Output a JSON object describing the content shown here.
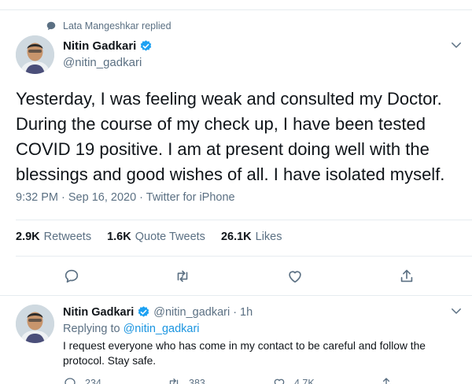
{
  "social_context": {
    "text": "Lata Mangeshkar replied",
    "icon": "reply-icon"
  },
  "tweet": {
    "author": {
      "name": "Nitin Gadkari",
      "handle": "@nitin_gadkari",
      "verified": true
    },
    "text": "Yesterday, I was feeling weak and consulted my Doctor. During the course of my check up, I have been tested COVID 19 positive. I am at present doing well with the blessings and good wishes of all. I have isolated myself.",
    "meta": "9:32 PM · Sep 16, 2020 · Twitter for iPhone",
    "stats": [
      {
        "count": "2.9K",
        "label": "Retweets"
      },
      {
        "count": "1.6K",
        "label": "Quote Tweets"
      },
      {
        "count": "26.1K",
        "label": "Likes"
      }
    ],
    "actions": [
      "reply-icon",
      "retweet-icon",
      "like-icon",
      "share-icon"
    ]
  },
  "reply": {
    "author": {
      "name": "Nitin Gadkari",
      "handle": "@nitin_gadkari",
      "time": "1h",
      "separator": "·",
      "verified": true
    },
    "replying_prefix": "Replying to ",
    "replying_to": "@nitin_gadkari",
    "text": "I request everyone who has come in my contact to be careful and follow the protocol. Stay safe.",
    "action_counts": {
      "reply": "234",
      "retweet": "383",
      "like": "4.7K"
    }
  },
  "colors": {
    "accent": "#1da1f2",
    "mention": "#1b95e0",
    "secondary_text": "#5b7083",
    "divider": "#e6ecf0"
  }
}
